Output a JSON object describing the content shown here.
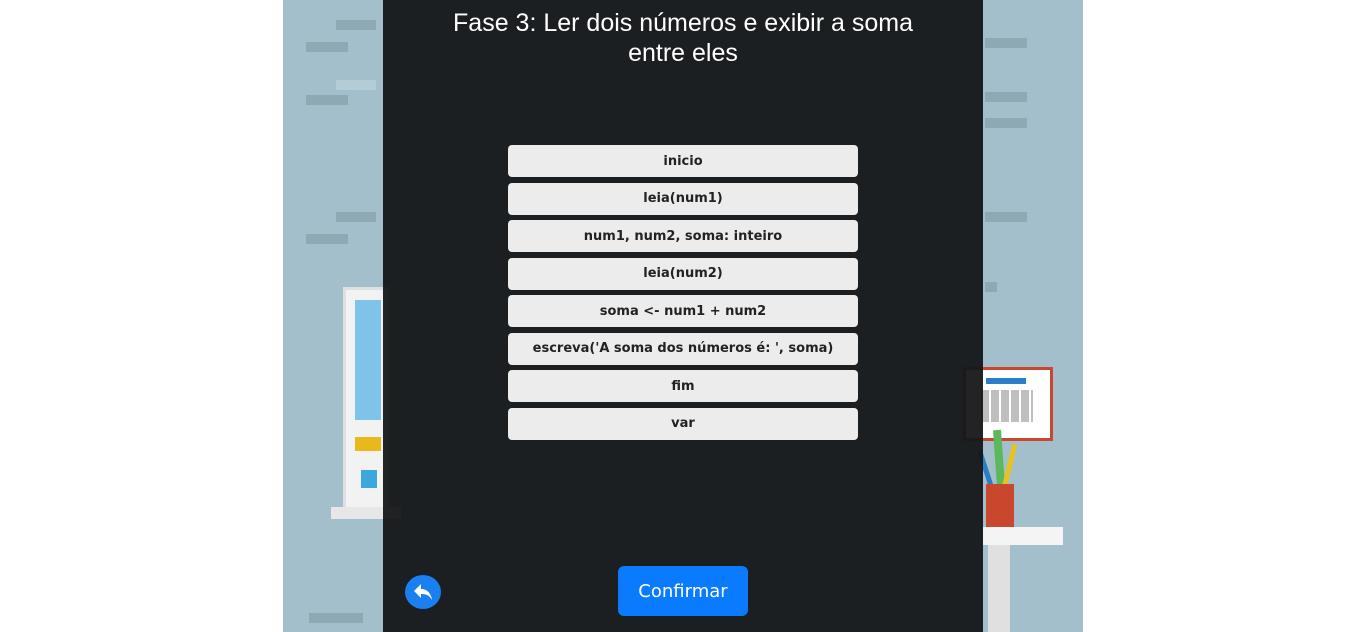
{
  "stage": {
    "title_line1": "Fase 3: Ler dois números e exibir a soma",
    "title_line2": "entre eles"
  },
  "blocks": [
    "inicio",
    "leia(num1)",
    "num1, num2, soma: inteiro",
    "leia(num2)",
    "soma <- num1 + num2",
    "escreva('A soma dos números é: ', soma)",
    "fim",
    "var"
  ],
  "actions": {
    "back_icon": "reply-arrow-icon",
    "confirm_label": "Confirmar"
  },
  "colors": {
    "panel_bg": "#131517",
    "block_bg": "#ececec",
    "accent": "#0a7bff"
  }
}
